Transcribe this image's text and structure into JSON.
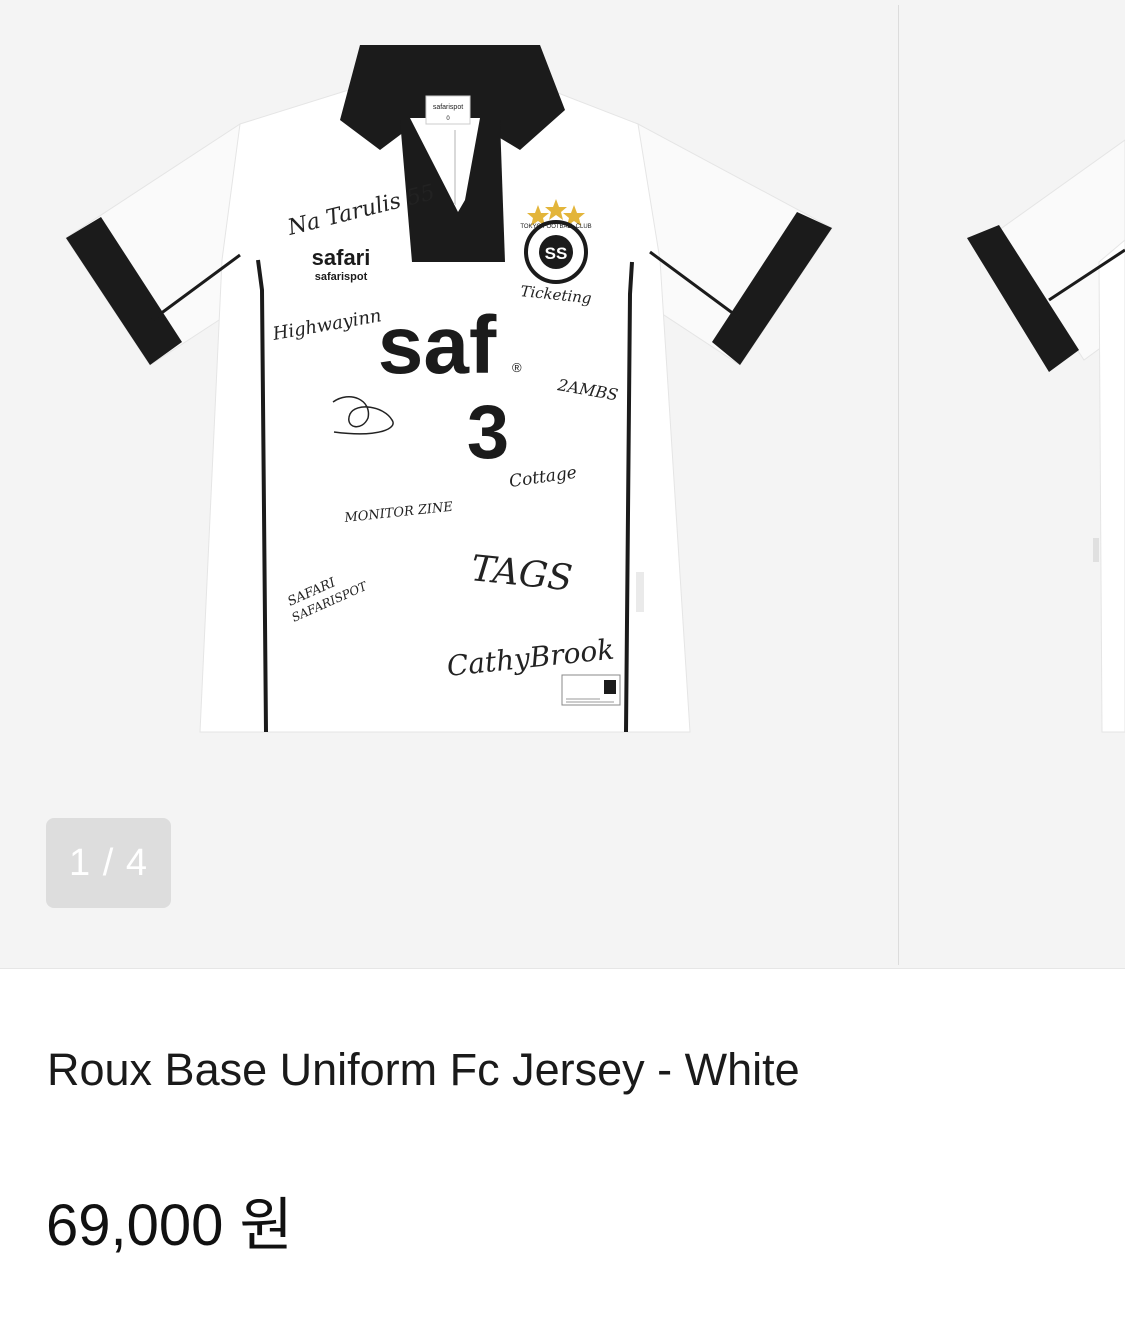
{
  "gallery": {
    "counter": "1 / 4",
    "jersey": {
      "collar_tag_brand": "safarispot",
      "collar_tag_size": "0",
      "chest_logo_1": "safari",
      "chest_logo_2": "safarispot",
      "badge_text": "TOKYO FOOTBALL CLUB",
      "main_logo": "saf",
      "main_logo_mark": "®",
      "number": "3",
      "signatures": {
        "s1": "Na Tarulis 55",
        "s2": "Highwayinn",
        "s3": "Ticketing",
        "s4": "2AMBS",
        "s5": "Cottage",
        "s6": "MONITOR ZINE",
        "s7": "TAGS",
        "s8": "SAFARI",
        "s9": "SAFARISPOT",
        "s10": "CathyBrook"
      },
      "colors": {
        "body": "#ffffff",
        "trim": "#1b1b1b",
        "stars": "#e3b53a"
      }
    }
  },
  "product": {
    "title": "Roux Base Uniform Fc Jersey - White",
    "price": "69,000 원"
  }
}
